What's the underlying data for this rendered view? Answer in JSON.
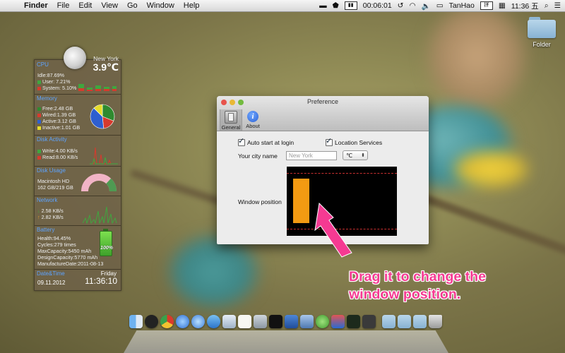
{
  "menubar": {
    "apple_glyph": "",
    "menus": [
      "Finder",
      "File",
      "Edit",
      "View",
      "Go",
      "Window",
      "Help"
    ],
    "status": {
      "battery_time": "00:06:01",
      "user": "TanHao",
      "clock": "11:36 五"
    }
  },
  "desktop": {
    "folder_label": "Folder"
  },
  "widget": {
    "weather": {
      "city": "New York",
      "temp": "3.9℃"
    },
    "cpu": {
      "title": "CPU",
      "idle": "Idle:87.69%",
      "user": "User: 7.21%",
      "system": "System: 5.10%"
    },
    "memory": {
      "title": "Memory",
      "free": "Free:2.48 GB",
      "wired": "Wired:1.39 GB",
      "active": "Active:3.12 GB",
      "inactive": "Inactive:1.01 GB",
      "pie": [
        {
          "label": "Free",
          "value": 2.48,
          "color": "#2f8a2f"
        },
        {
          "label": "Wired",
          "value": 1.39,
          "color": "#d63a2d"
        },
        {
          "label": "Active",
          "value": 3.12,
          "color": "#2e5fd0"
        },
        {
          "label": "Inactive",
          "value": 1.01,
          "color": "#e6dc2a"
        }
      ]
    },
    "disk_activity": {
      "title": "Disk Activity",
      "write": "Write:4.00 KB/s",
      "read": "Read:8.00 KB/s"
    },
    "disk_usage": {
      "title": "Disk Usage",
      "volume": "Macintosh HD",
      "usage": "162 GB/219 GB",
      "used_fraction": 0.74
    },
    "network": {
      "title": "Network",
      "down": "2.58 KB/s",
      "up": "2.82 KB/s"
    },
    "battery": {
      "title": "Battery",
      "health": "Health:94.45%",
      "cycles": "Cycles:279 times",
      "max_capacity": "MaxCapacity:5450 mAh",
      "design_capacity": "DesignCapacity:5770 mAh",
      "manufacture_date": "ManufactureDate:2011-08-13",
      "charge_label": "100%"
    },
    "datetime": {
      "title": "Date&Time",
      "day": "Friday",
      "date": "09.11.2012",
      "time": "11:36:10"
    }
  },
  "preference": {
    "title": "Preference",
    "tabs": {
      "general": "General",
      "about": "About"
    },
    "auto_start": "Auto start at login",
    "location_services": "Location Services",
    "city_label": "Your city name",
    "city_placeholder": "New York",
    "unit": "℃",
    "window_position_label": "Window position"
  },
  "annotation": {
    "line1": "Drag it to change the",
    "line2": "window position."
  },
  "colors": {
    "annotation": "#f53a92",
    "handle": "#f39a12",
    "section_title": "#5da3ff"
  },
  "dock": {
    "apps": [
      "finder-icon",
      "qq-icon",
      "chrome-icon",
      "safari-icon",
      "itunes-icon",
      "app-store-icon",
      "mail-icon",
      "textedit-icon",
      "preview-icon",
      "terminal-icon",
      "word-icon",
      "xcode-icon",
      "evernote-icon",
      "parallels-icon",
      "activity-monitor-icon",
      "system-monitor-icon"
    ],
    "stacks": [
      "applications-folder-icon",
      "documents-folder-icon",
      "downloads-folder-icon",
      "trash-icon"
    ]
  }
}
